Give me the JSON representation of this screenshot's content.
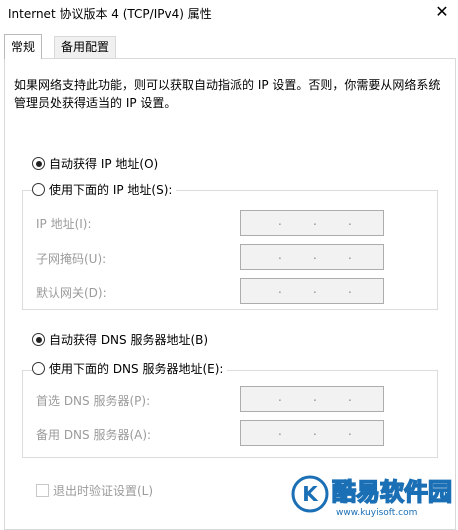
{
  "window": {
    "title": "Internet 协议版本 4 (TCP/IPv4) 属性",
    "close_icon": "close-icon"
  },
  "tabs": [
    {
      "label": "常规"
    },
    {
      "label": "备用配置"
    }
  ],
  "description": "如果网络支持此功能，则可以获取自动指派的 IP 设置。否则，你需要从网络系统管理员处获得适当的 IP 设置。",
  "ip_section": {
    "auto_label": "自动获得 IP 地址(O)",
    "manual_label": "使用下面的 IP 地址(S):",
    "fields": [
      {
        "label": "IP 地址(I):"
      },
      {
        "label": "子网掩码(U):"
      },
      {
        "label": "默认网关(D):"
      }
    ]
  },
  "dns_section": {
    "auto_label": "自动获得 DNS 服务器地址(B)",
    "manual_label": "使用下面的 DNS 服务器地址(E):",
    "fields": [
      {
        "label": "首选 DNS 服务器(P):"
      },
      {
        "label": "备用 DNS 服务器(A):"
      }
    ]
  },
  "validate_label": "退出时验证设置(L)",
  "watermark": {
    "logo_letter": "K",
    "text": "酷易软件园",
    "url": "www.kuyisoft.com"
  },
  "colors": {
    "disabled_text": "#9b9b9b",
    "field_bg": "#f2f2f2",
    "watermark_blue": "#1a6fb5"
  }
}
